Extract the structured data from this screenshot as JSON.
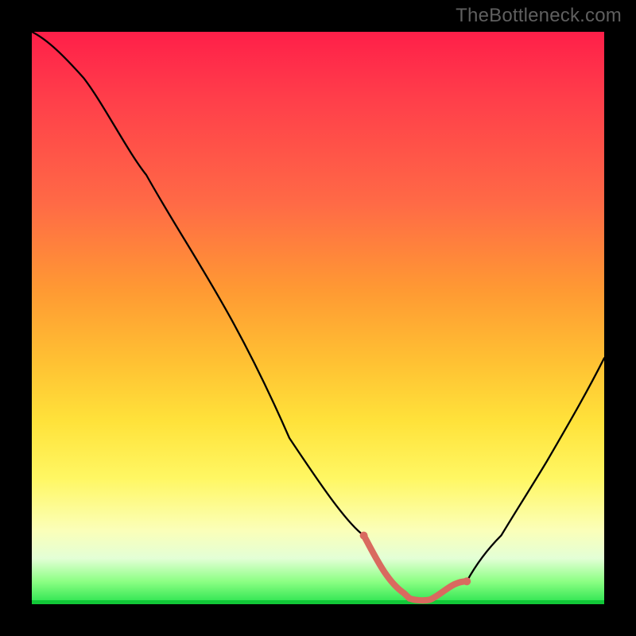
{
  "watermark": "TheBottleneck.com",
  "chart_data": {
    "type": "line",
    "title": "",
    "xlabel": "",
    "ylabel": "",
    "xlim": [
      0,
      100
    ],
    "ylim": [
      0,
      100
    ],
    "background_gradient": {
      "direction": "vertical",
      "stops": [
        {
          "pos": 0,
          "color": "#ff1f49"
        },
        {
          "pos": 12,
          "color": "#ff3f4a"
        },
        {
          "pos": 30,
          "color": "#ff6a46"
        },
        {
          "pos": 45,
          "color": "#ff9933"
        },
        {
          "pos": 58,
          "color": "#ffc233"
        },
        {
          "pos": 68,
          "color": "#ffe23a"
        },
        {
          "pos": 78,
          "color": "#fff763"
        },
        {
          "pos": 87,
          "color": "#fbffb8"
        },
        {
          "pos": 92,
          "color": "#e3ffd6"
        },
        {
          "pos": 96,
          "color": "#8dff84"
        },
        {
          "pos": 100,
          "color": "#27e34e"
        }
      ]
    },
    "series": [
      {
        "name": "bottleneck-curve",
        "color": "#000000",
        "x": [
          0,
          5,
          9,
          20,
          35,
          50,
          58,
          62,
          66,
          70,
          75,
          82,
          90,
          100
        ],
        "y": [
          100,
          97,
          92,
          75,
          52,
          29,
          12,
          4,
          1,
          1,
          4,
          12,
          25,
          43
        ]
      }
    ],
    "highlight_segment": {
      "name": "minimum-region",
      "color": "#d96a5f",
      "x_start": 58,
      "x_end": 76,
      "y_approx": 1
    }
  }
}
